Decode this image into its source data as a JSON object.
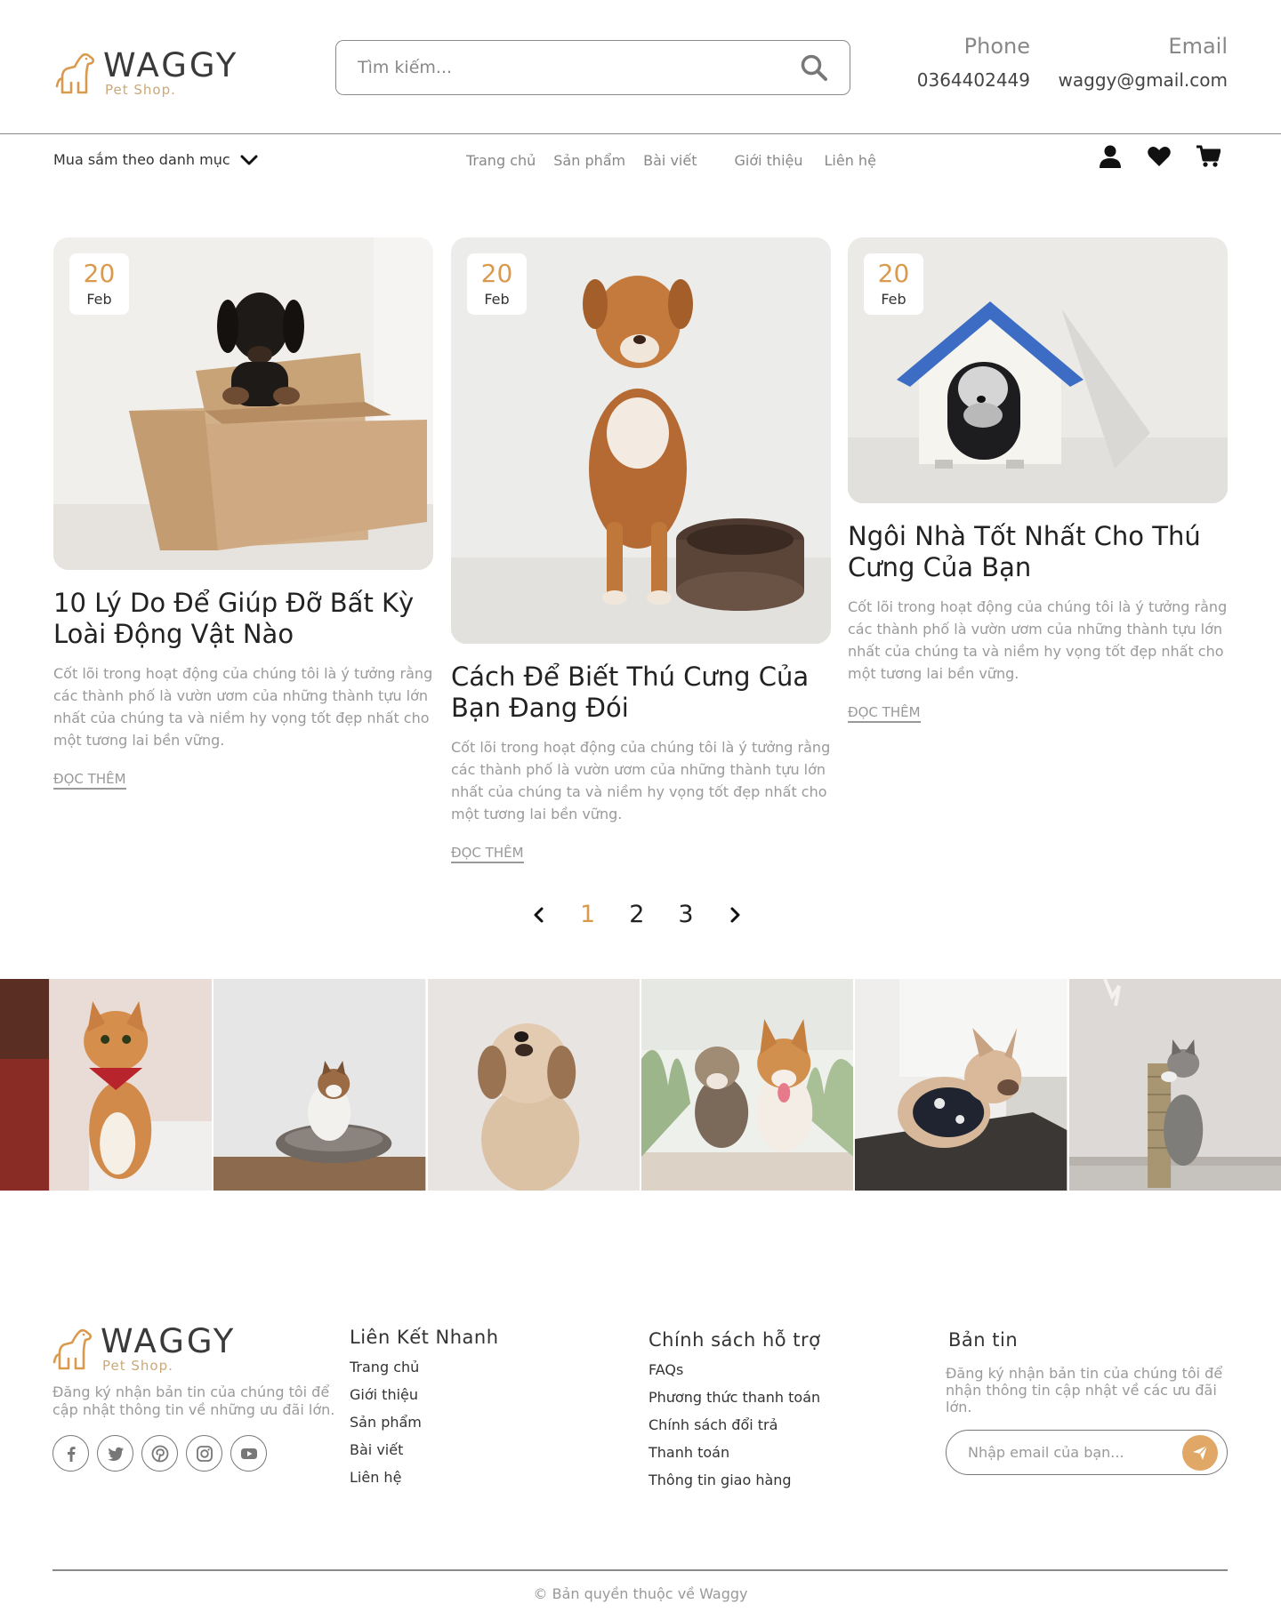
{
  "colors": {
    "accent": "#d99a4e",
    "text": "#222222",
    "muted": "#9a9a9a",
    "border": "#8a8a8a"
  },
  "header": {
    "brand": "WAGGY",
    "tagline": "Pet Shop.",
    "search": {
      "placeholder": "Tìm kiếm...",
      "icon": "search-icon"
    },
    "phone": {
      "label": "Phone",
      "value": "0364402449"
    },
    "email": {
      "label": "Email",
      "value": "waggy@gmail.com"
    }
  },
  "nav": {
    "category_label": "Mua sắm theo danh mục",
    "links": [
      "Trang chủ",
      "Sản phẩm",
      "Bài viết",
      "Giới thiệu",
      "Liên hệ"
    ],
    "icons": [
      "user-icon",
      "heart-icon",
      "cart-icon"
    ]
  },
  "posts": [
    {
      "day": "20",
      "month": "Feb",
      "title": "10 Lý Do Để Giúp Đỡ Bất Kỳ Loài Động Vật Nào",
      "excerpt": "Cốt lõi trong hoạt động của chúng tôi là ý tưởng rằng các thành phố là vườn ươm của những thành tựu lớn nhất của chúng ta và niềm hy vọng tốt đẹp nhất cho một tương lai bền vững.",
      "read_more": "ĐỌC THÊM"
    },
    {
      "day": "20",
      "month": "Feb",
      "title": "Cách Để Biết Thú Cưng Của Bạn Đang Đói",
      "excerpt": "Cốt lõi trong hoạt động của chúng tôi là ý tưởng rằng các thành phố là vườn ươm của những thành tựu lớn nhất của chúng ta và niềm hy vọng tốt đẹp nhất cho một tương lai bền vững.",
      "read_more": "ĐỌC THÊM"
    },
    {
      "day": "20",
      "month": "Feb",
      "title": "Ngôi Nhà Tốt Nhất Cho Thú Cưng Của Bạn",
      "excerpt": "Cốt lõi trong hoạt động của chúng tôi là ý tưởng rằng các thành phố là vườn ươm của những thành tựu lớn nhất của chúng ta và niềm hy vọng tốt đẹp nhất cho một tương lai bền vững.",
      "read_more": "ĐỌC THÊM"
    }
  ],
  "pagination": {
    "pages": [
      "1",
      "2",
      "3"
    ],
    "current": "1"
  },
  "footer": {
    "brand": "WAGGY",
    "tagline": "Pet Shop.",
    "about": "Đăng ký nhận bản tin của chúng tôi để cập nhật thông tin về những ưu đãi lớn.",
    "socials": [
      "facebook-icon",
      "twitter-icon",
      "pinterest-icon",
      "instagram-icon",
      "youtube-icon"
    ],
    "quick_links": {
      "title": "Liên Kết Nhanh",
      "items": [
        "Trang chủ",
        "Giới thiệu",
        "Sản phẩm",
        "Bài viết",
        "Liên hệ"
      ]
    },
    "support": {
      "title": "Chính sách hỗ trợ",
      "items": [
        "FAQs",
        "Phương thức thanh toán",
        "Chính sách đổi trả",
        "Thanh toán",
        "Thông tin giao hàng"
      ]
    },
    "newsletter": {
      "title": "Bản tin",
      "text": "Đăng ký nhận bản tin của chúng tôi để nhận thông tin cập nhật về các ưu đãi lớn.",
      "placeholder": "Nhập email của bạn..."
    },
    "copyright": "© Bản quyền thuộc về Waggy"
  }
}
